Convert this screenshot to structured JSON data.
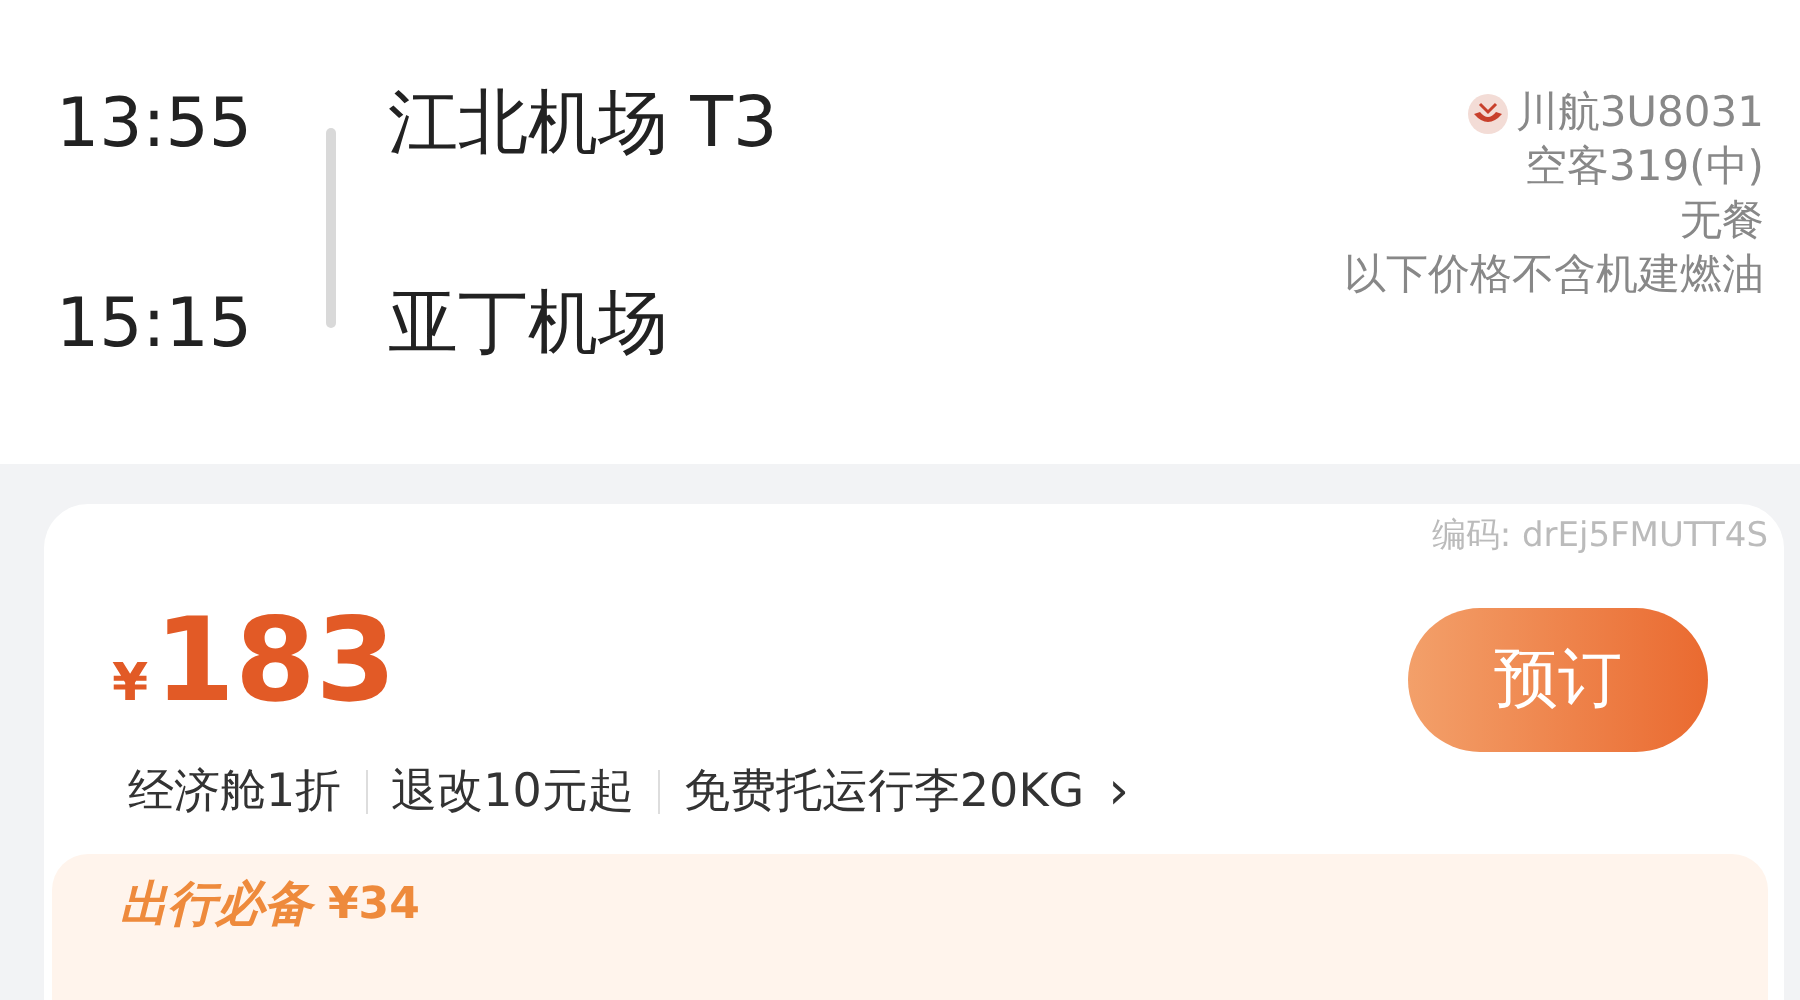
{
  "flight": {
    "departure": {
      "time": "13:55",
      "airport": "江北机场 T3"
    },
    "arrival": {
      "time": "15:15",
      "airport": "亚丁机场"
    },
    "info": [
      "川航3U8031",
      "空客319(中)",
      "无餐",
      "以下价格不含机建燃油"
    ]
  },
  "offer": {
    "code": "编码: drEj5FMUTT4S",
    "currency": "¥",
    "price": "183",
    "button": "预订",
    "tags": [
      "经济舱1折",
      "退改10元起",
      "免费托运行李20KG"
    ],
    "more": "›",
    "extras": {
      "title": "出行必备",
      "price": "¥34"
    }
  }
}
